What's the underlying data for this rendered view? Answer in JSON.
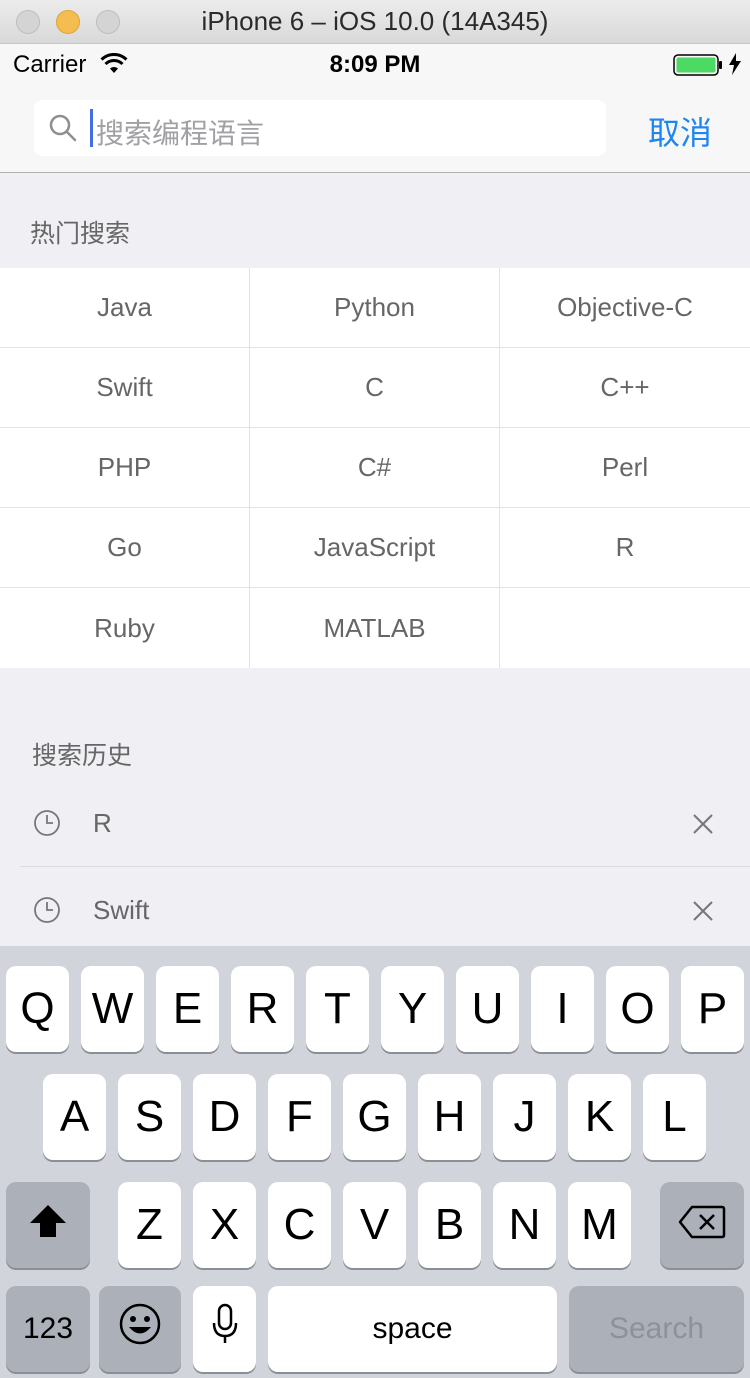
{
  "simulator": {
    "title": "iPhone 6 – iOS 10.0 (14A345)"
  },
  "status_bar": {
    "carrier": "Carrier",
    "time": "8:09 PM",
    "battery_color": "#4cd964"
  },
  "search": {
    "placeholder": "搜索编程语言",
    "cancel_label": "取消",
    "accent": "#1f86f0"
  },
  "hot_section": {
    "title": "热门搜索",
    "items": [
      "Java",
      "Python",
      "Objective-C",
      "Swift",
      "C",
      "C++",
      "PHP",
      "C#",
      "Perl",
      "Go",
      "JavaScript",
      "R",
      "Ruby",
      "MATLAB",
      ""
    ]
  },
  "history_section": {
    "title": "搜索历史",
    "items": [
      {
        "label": "R",
        "icon": "clock-icon",
        "action_icon": "close-icon"
      },
      {
        "label": "Swift",
        "icon": "clock-icon",
        "action_icon": "close-icon"
      }
    ]
  },
  "keyboard": {
    "row1": [
      "Q",
      "W",
      "E",
      "R",
      "T",
      "Y",
      "U",
      "I",
      "O",
      "P"
    ],
    "row2": [
      "A",
      "S",
      "D",
      "F",
      "G",
      "H",
      "J",
      "K",
      "L"
    ],
    "row3": [
      "Z",
      "X",
      "C",
      "V",
      "B",
      "N",
      "M"
    ],
    "numbers_label": "123",
    "space_label": "space",
    "search_label": "Search",
    "shift_icon": "shift-icon",
    "delete_icon": "backspace-icon",
    "emoji_icon": "emoji-icon",
    "mic_icon": "microphone-icon"
  }
}
